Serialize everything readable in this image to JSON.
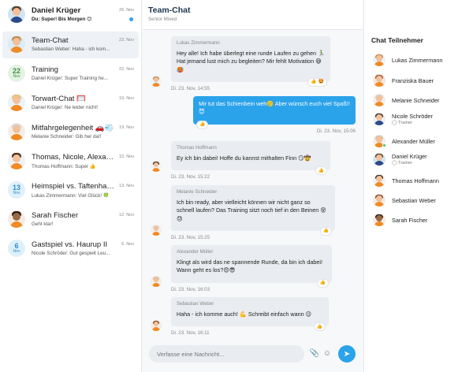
{
  "sidebar": {
    "conversations": [
      {
        "title": "Daniel Krüger",
        "subtitle": "Du: Super! Bis Morgen 😊",
        "date": "26. Nov",
        "unread": true,
        "bold": true
      },
      {
        "title": "Team-Chat",
        "subtitle": "Sebastian Weber: Haha - ich kom...",
        "date": "23. Nov",
        "active": true
      },
      {
        "title": "Training",
        "subtitle": "Daniel Krüger: Super Training he...",
        "date": "22. Nov",
        "badge_day": "22",
        "badge_month": "Nov"
      },
      {
        "title": "Torwart-Chat 🥅",
        "subtitle": "Daniel Krüger: Ne leider nicht!",
        "date": "19. Nov"
      },
      {
        "title": "Mitfahrgelegenheit 🚗💨",
        "subtitle": "Melanie Schneider: Gib her da!!",
        "date": "19. Nov"
      },
      {
        "title": "Thomas, Nicole, Alexander...",
        "subtitle": "Thomas Hoffmann: Super 👍",
        "date": "15. Nov"
      },
      {
        "title": "Heimspiel vs. Taftenhausen",
        "subtitle": "Lukas Zimmermann: Viel Glück! 🍀",
        "date": "13. Nov",
        "badge_day": "13",
        "badge_month": "Nov"
      },
      {
        "title": "Sarah Fischer",
        "subtitle": "Geht klar!",
        "date": "12. Nov"
      },
      {
        "title": "Gastspiel vs. Haurup II",
        "subtitle": "Nicole Schröder: Gut gespielt Leu...",
        "date": "6. Nov",
        "badge_day": "6",
        "badge_month": "Nov"
      }
    ]
  },
  "chat": {
    "title": "Team-Chat",
    "subtitle": "Senior Mixed",
    "messages": [
      {
        "sender": "Lukas Zimmermann",
        "text": "Hey alle! Ich habe überlegt eine runde Laufen zu gehen 🏃‍♂️ Hat jemand lust mich zu begleiten? Mir fehlt Motivation 😅🥵",
        "time": "Di. 23. Nov, 14:55",
        "reactions": "👍 🤩"
      },
      {
        "sender": "",
        "text": "Mir tut das Schienbein weh🥲 Aber wünsch euch viel Spaß!! 😈",
        "time": "Di. 23. Nov, 15:06",
        "reactions": "👍"
      },
      {
        "sender": "Thomas Hoffmann",
        "text": "Ey ich bin dabei! Hoffe du kannst mithalten Finn 😏🤠",
        "time": "Di. 23. Nov, 15:22",
        "reactions": "👍"
      },
      {
        "sender": "Melanie Schneider",
        "text": "Ich bin ready, aber vielleicht können wir nicht ganz so schnell laufen? Das Training sitzt noch tief in den Beinen 😵😓",
        "time": "Di. 23. Nov, 15:25",
        "reactions": "👍"
      },
      {
        "sender": "Alexander Müller",
        "text": "Klingt als wird das ne spannende Runde, da bin ich dabei! Wann geht es los?😍😎",
        "time": "Di. 23. Nov, 16:03",
        "reactions": "👍"
      },
      {
        "sender": "Sebastian Weber",
        "text": "Haha - ich komme auch! 💪 Schreibt einfach wann 😉",
        "time": "Di. 23. Nov, 16:11",
        "reactions": "👍"
      }
    ],
    "composer_placeholder": "Verfasse eine Nachricht...",
    "attach_icon": "paperclip-icon",
    "emoji_icon": "smiley-icon",
    "send_icon": "send-icon"
  },
  "members": {
    "title": "Chat Teilnehmer",
    "list": [
      {
        "name": "Lukas Zimmermann"
      },
      {
        "name": "Franziska Bauer"
      },
      {
        "name": "Melanie Schneider"
      },
      {
        "name": "Nicole Schröder",
        "role": "Trainer"
      },
      {
        "name": "Alexander Müller",
        "online": true
      },
      {
        "name": "Daniel Krüger",
        "role": "Trainer"
      },
      {
        "name": "Thomas Hoffmann"
      },
      {
        "name": "Sebastian Weber"
      },
      {
        "name": "Sarah Fischer"
      }
    ]
  },
  "colors": {
    "accent": "#2ba3ea",
    "online": "#3cc06a",
    "jersey": "#f08a24"
  }
}
